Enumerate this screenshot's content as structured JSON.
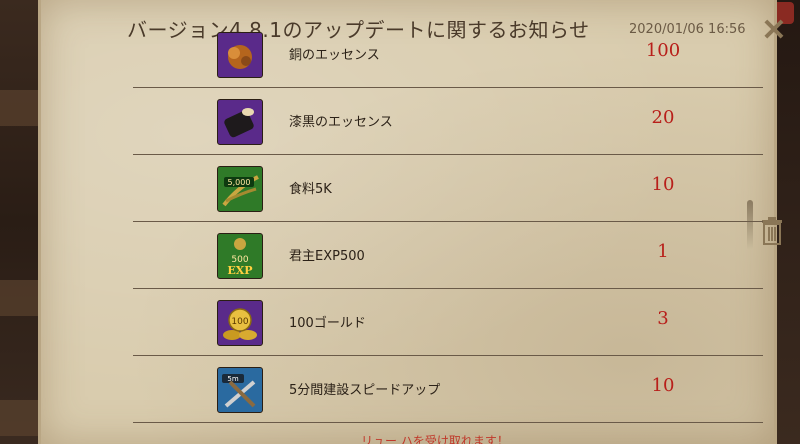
{
  "header": {
    "title": "バージョン4.8.1のアップデートに関するお知らせ",
    "date": "2020/01/06 16:56"
  },
  "items": [
    {
      "name": "銅のエッセンス",
      "qty": "100",
      "icon": "bronze-essence-icon"
    },
    {
      "name": "漆黒のエッセンス",
      "qty": "20",
      "icon": "jet-black-essence-icon"
    },
    {
      "name": "食料5K",
      "qty": "10",
      "icon": "food-5k-icon",
      "badge": "5,000"
    },
    {
      "name": "君主EXP500",
      "qty": "1",
      "icon": "lord-exp-500-icon",
      "badge": "500",
      "badge2": "EXP"
    },
    {
      "name": "100ゴールド",
      "qty": "3",
      "icon": "gold-100-icon",
      "badge": "100"
    },
    {
      "name": "5分間建設スピードアップ",
      "qty": "10",
      "icon": "construction-speedup-5m-icon",
      "badge": "5m"
    }
  ],
  "footer_partial": "リュー ハを受け取れます！",
  "colors": {
    "parchment": "#d9ccae",
    "quantity": "#b81f1a",
    "title": "#4a3a2a"
  }
}
